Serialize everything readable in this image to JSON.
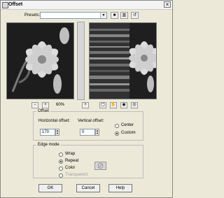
{
  "window": {
    "title": "Offset",
    "close_symbol": "×"
  },
  "toolbar": {
    "presets_label": "Presets:",
    "preset_value": ""
  },
  "zoom": {
    "zoom_out": "−",
    "zoom_in": "+",
    "value": "60%"
  },
  "offset": {
    "legend": "Offset",
    "horizontal_label": "Horizontal offset:",
    "horizontal_value": "170",
    "vertical_label": "Vertical offset:",
    "vertical_value": "0",
    "center_label": "Center",
    "custom_label": "Custom"
  },
  "edge_mode": {
    "legend": "Edge mode",
    "wrap": "Wrap",
    "repeat": "Repeat",
    "color": "Color",
    "transparent": "Transparent"
  },
  "buttons": {
    "ok": "OK",
    "cancel": "Cancel",
    "help": "Help"
  }
}
